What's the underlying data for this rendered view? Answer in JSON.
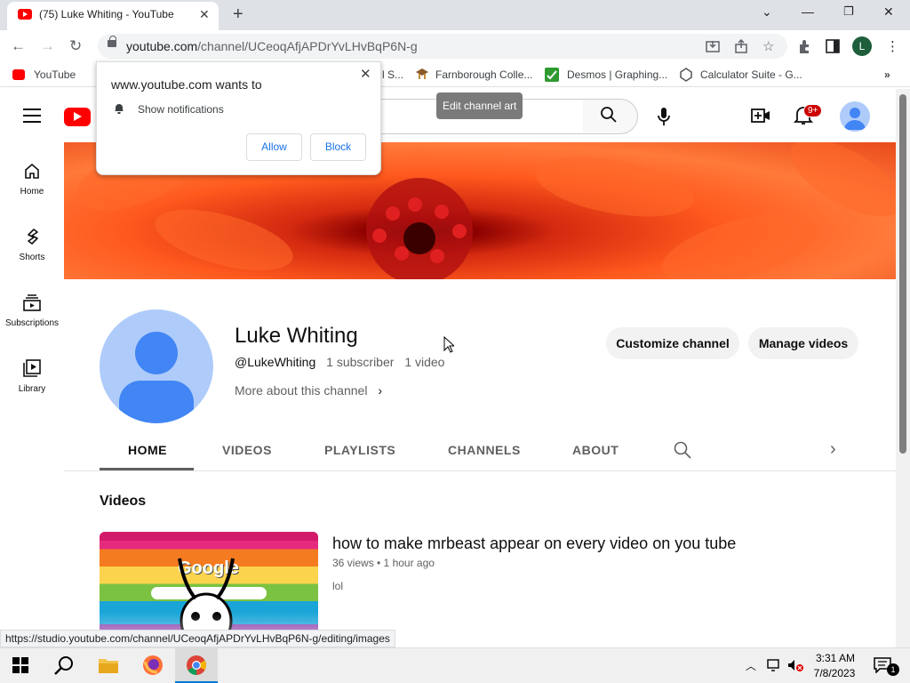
{
  "browser": {
    "tab_title": "(75) Luke Whiting - YouTube",
    "url_host": "youtube.com",
    "url_path": "/channel/UCeoqAfjAPDrYvLHvBqP6N-g",
    "profile_initial": "L",
    "status_url": "https://studio.youtube.com/channel/UCeoqAfjAPDrYvLHvBqP6N-g/editing/images"
  },
  "bookmarks": [
    {
      "label": "YouTube"
    },
    {
      "label": "l S..."
    },
    {
      "label": "Farnborough Colle..."
    },
    {
      "label": "Desmos | Graphing..."
    },
    {
      "label": "Calculator Suite - G..."
    }
  ],
  "permission_popup": {
    "title": "www.youtube.com wants to",
    "message": "Show notifications",
    "allow_label": "Allow",
    "block_label": "Block"
  },
  "header": {
    "tooltip": "Edit channel art",
    "notification_count": "9+"
  },
  "guide": [
    {
      "label": "Home"
    },
    {
      "label": "Shorts"
    },
    {
      "label": "Subscriptions"
    },
    {
      "label": "Library"
    }
  ],
  "channel": {
    "name": "Luke Whiting",
    "handle": "@LukeWhiting",
    "subscribers": "1 subscriber",
    "videos": "1 video",
    "more_about": "More about this channel",
    "customize_label": "Customize channel",
    "manage_label": "Manage videos"
  },
  "tabs": [
    {
      "label": "HOME"
    },
    {
      "label": "VIDEOS"
    },
    {
      "label": "PLAYLISTS"
    },
    {
      "label": "CHANNELS"
    },
    {
      "label": "ABOUT"
    }
  ],
  "videos_section": {
    "title": "Videos",
    "items": [
      {
        "title": "how to make mrbeast appear on every video on you tube",
        "meta": "36 views • 1 hour ago",
        "description": "lol",
        "thumb_text": "Google"
      }
    ]
  },
  "taskbar": {
    "time": "3:31 AM",
    "date": "7/8/2023"
  }
}
